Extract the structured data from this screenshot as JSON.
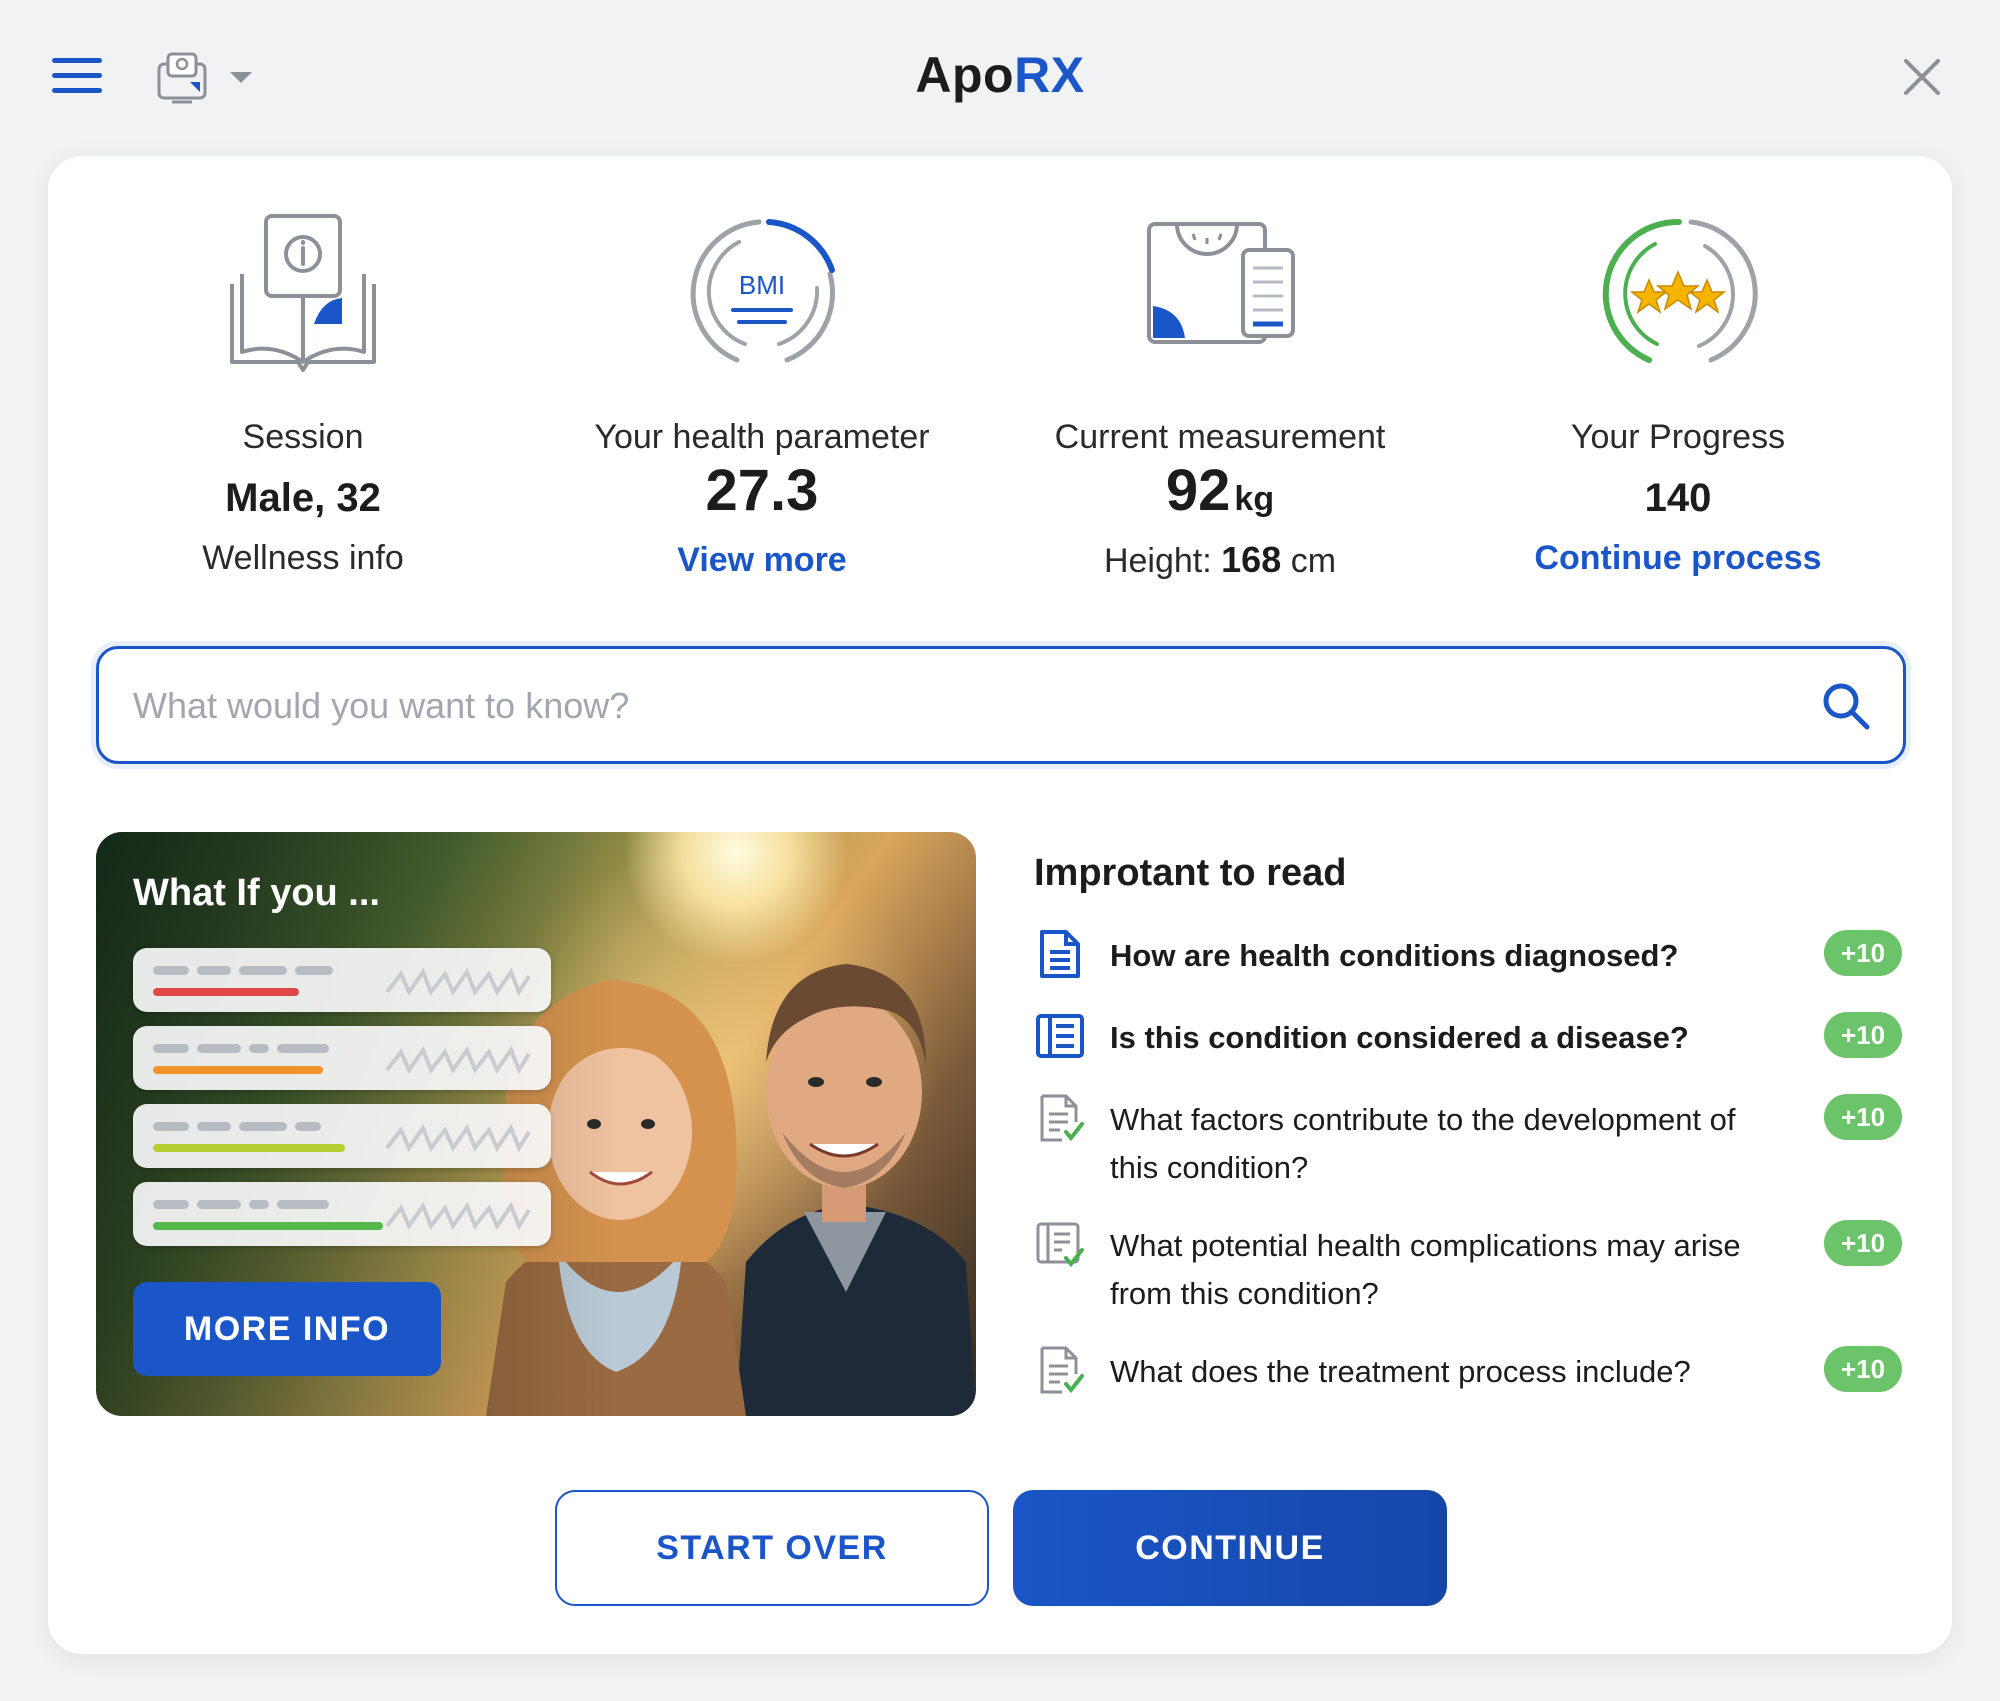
{
  "app": {
    "brand_part1": "Apo",
    "brand_part2": "RX",
    "accent_color": "#1a56c8",
    "badge_color": "#6cc46a"
  },
  "stats": [
    {
      "label": "Session",
      "value": "Male, 32",
      "sub": "Wellness info",
      "icon": "book-info-icon"
    },
    {
      "label": "Your health parameter",
      "value": "27.3",
      "link": "View more",
      "icon": "bmi-gauge-icon",
      "icon_text": "BMI"
    },
    {
      "label": "Current measurement",
      "value": "92",
      "unit": "kg",
      "sub_label": "Height:",
      "sub_value": "168",
      "sub_unit": "cm",
      "icon": "scale-icon"
    },
    {
      "label": "Your Progress",
      "value": "140",
      "link": "Continue process",
      "icon": "stars-progress-icon"
    }
  ],
  "search": {
    "placeholder": "What would you want to know?",
    "value": ""
  },
  "promo": {
    "title": "What If you ...",
    "button": "MORE INFO"
  },
  "reading": {
    "title": "Improtant to read",
    "items": [
      {
        "text": "How are health conditions diagnosed?",
        "badge": "+10",
        "icon": "document-icon"
      },
      {
        "text": "Is this condition considered a disease?",
        "badge": "+10",
        "icon": "list-document-icon"
      },
      {
        "text": "What factors contribute to the development of this condition?",
        "badge": "+10",
        "icon": "document-check-icon"
      },
      {
        "text": "What potential health complications may arise from this condition?",
        "badge": "+10",
        "icon": "list-document-check-icon"
      },
      {
        "text": "What does the treatment process include?",
        "badge": "+10",
        "icon": "document-check-icon"
      }
    ]
  },
  "actions": {
    "start_over": "START OVER",
    "continue": "CONTINUE"
  }
}
